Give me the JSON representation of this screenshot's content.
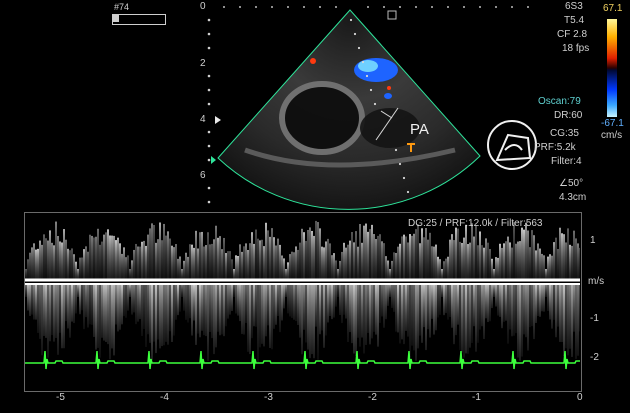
{
  "header": {
    "frame_number": "#74",
    "probe": "6S3"
  },
  "image_params": {
    "t": "T5.4",
    "cf": "CF 2.8",
    "fps": "18 fps",
    "oscan": "Oscan:79",
    "dr": "DR:60",
    "cg": "CG:35",
    "prf": "PRF:5.2k",
    "filter": "Filter:4",
    "angle": "∠50°",
    "depth_cm": "4.3cm"
  },
  "colorbar": {
    "max": "67.1",
    "min": "-67.1",
    "unit": "cm/s"
  },
  "depth_scale": {
    "ticks": [
      "0",
      "2",
      "4",
      "6"
    ]
  },
  "annotation": {
    "pa_label": "PA"
  },
  "doppler": {
    "header": "DG:25 /   PRF:12.0k / Filter:563",
    "unit": "m/s",
    "y_ticks": [
      "1",
      "-1",
      "-2"
    ],
    "x_ticks": [
      "-5",
      "-4",
      "-3",
      "-2",
      "-1",
      "0"
    ]
  },
  "colors": {
    "sector_outline": "#2ee39a",
    "ecg": "#3cff3c",
    "flow_blue": "#1e64ff",
    "flow_red": "#ff3a10"
  }
}
